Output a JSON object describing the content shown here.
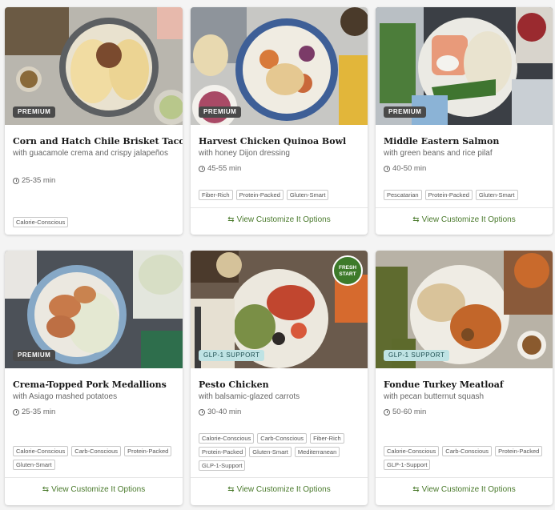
{
  "cards": [
    {
      "badge": "PREMIUM",
      "title": "Corn and Hatch Chile Brisket Tacos",
      "subtitle": "with guacamole crema and crispy jalapeños",
      "time": "25-35 min",
      "tags": [
        "Calorie-Conscious"
      ],
      "link": ""
    },
    {
      "badge": "PREMIUM",
      "title": "Harvest Chicken Quinoa Bowl",
      "subtitle": "with honey Dijon dressing",
      "time": "45-55 min",
      "tags": [
        "Fiber-Rich",
        "Protein-Packed",
        "Gluten-Smart"
      ],
      "link": "View Customize It Options"
    },
    {
      "badge": "PREMIUM",
      "title": "Middle Eastern Salmon",
      "subtitle": "with green beans and rice pilaf",
      "time": "40-50 min",
      "tags": [
        "Pescatarian",
        "Protein-Packed",
        "Gluten-Smart"
      ],
      "link": "View Customize It Options"
    },
    {
      "badge": "PREMIUM",
      "title": "Crema-Topped Pork Medallions",
      "subtitle": "with Asiago mashed potatoes",
      "time": "25-35 min",
      "tags": [
        "Calorie-Conscious",
        "Carb-Conscious",
        "Protein-Packed",
        "Gluten-Smart"
      ],
      "link": "View Customize It Options"
    },
    {
      "badge": "GLP-1 SUPPORT",
      "title": "Pesto Chicken",
      "subtitle": "with balsamic-glazed carrots",
      "time": "30-40 min",
      "tags": [
        "Calorie-Conscious",
        "Carb-Conscious",
        "Fiber-Rich",
        "Protein-Packed",
        "Gluten-Smart",
        "Mediterranean",
        "GLP-1-Support"
      ],
      "link": "View Customize It Options",
      "sticker_line1": "FRESH",
      "sticker_line2": "START"
    },
    {
      "badge": "GLP-1 SUPPORT",
      "title": "Fondue Turkey Meatloaf",
      "subtitle": "with pecan butternut squash",
      "time": "50-60 min",
      "tags": [
        "Calorie-Conscious",
        "Carb-Conscious",
        "Protein-Packed",
        "GLP-1-Support"
      ],
      "link": "View Customize It Options"
    }
  ],
  "colors": {
    "link_green": "#4a7a2c",
    "premium_badge": "#4a4a4a",
    "glp_badge": "#bfe3e4"
  }
}
